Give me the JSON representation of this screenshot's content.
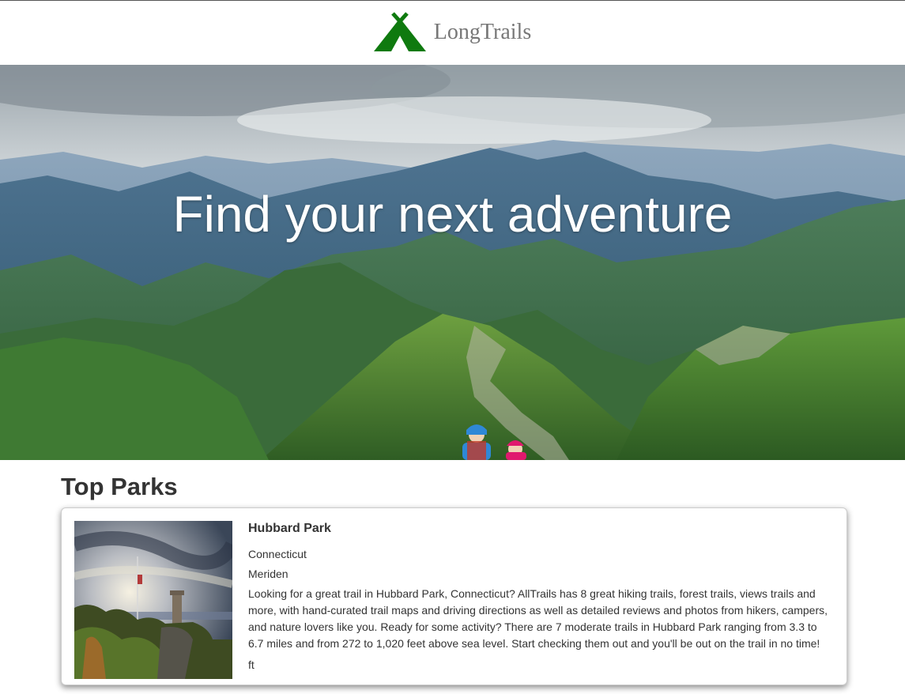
{
  "brand": {
    "name": "LongTrails",
    "logo_icon": "tent-icon",
    "color": "#0f7a0f"
  },
  "hero": {
    "title": "Find your next adventure"
  },
  "top_parks": {
    "heading": "Top Parks",
    "parks": [
      {
        "name": "Hubbard Park",
        "state": "Connecticut",
        "city": "Meriden",
        "description": "Looking for a great trail in Hubbard Park, Connecticut? AllTrails has 8 great hiking trails, forest trails, views trails and more, with hand-curated trail maps and driving directions as well as detailed reviews and photos from hikers, campers, and nature lovers like you. Ready for some activity? There are 7 moderate trails in Hubbard Park ranging from 3.3 to 6.7 miles and from 272 to 1,020 feet above sea level. Start checking them out and you'll be out on the trail in no time!",
        "elevation_unit": "ft"
      }
    ]
  }
}
